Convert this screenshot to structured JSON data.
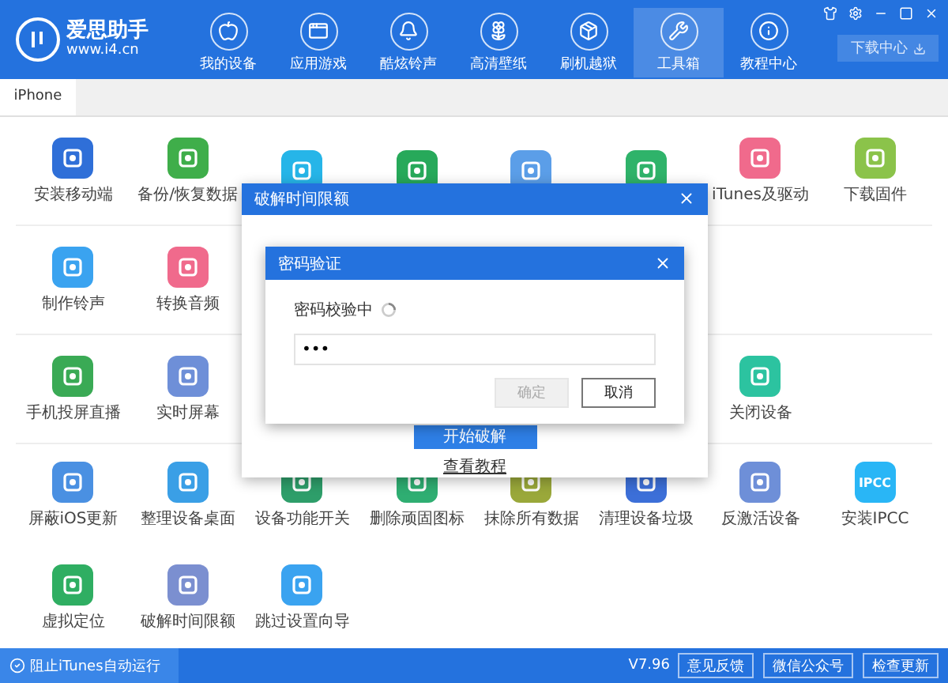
{
  "app": {
    "name": "爱思助手",
    "url": "www.i4.cn"
  },
  "nav": [
    {
      "label": "我的设备",
      "selected": false
    },
    {
      "label": "应用游戏",
      "selected": false
    },
    {
      "label": "酷炫铃声",
      "selected": false
    },
    {
      "label": "高清壁纸",
      "selected": false
    },
    {
      "label": "刷机越狱",
      "selected": false
    },
    {
      "label": "工具箱",
      "selected": true
    },
    {
      "label": "教程中心",
      "selected": false
    }
  ],
  "download_button": "下载中心",
  "tabs": [
    {
      "label": "iPhone",
      "selected": true
    }
  ],
  "tool_rows": [
    [
      {
        "kind": "tool",
        "label": "安装移动端",
        "color": "#2f6fd8"
      },
      {
        "kind": "tool",
        "label": "备份/恢复数据",
        "color": "#3fae4a"
      },
      {
        "kind": "tool",
        "color": "#26b5e8"
      },
      {
        "kind": "tool",
        "color": "#27a95a"
      },
      {
        "kind": "tool",
        "color": "#5b9ee8"
      },
      {
        "kind": "tool",
        "color": "#2fb36a"
      },
      {
        "kind": "tool",
        "label": "iTunes及驱动",
        "color": "#f06a8c"
      },
      {
        "kind": "tool",
        "label": "下载固件",
        "color": "#8bc34a"
      }
    ],
    [
      {
        "kind": "tool",
        "label": "制作铃声",
        "color": "#3aa3f0"
      },
      {
        "kind": "tool",
        "label": "转换音频",
        "color": "#f06a8c"
      },
      {
        "kind": "blank"
      },
      {
        "kind": "blank"
      },
      {
        "kind": "blank"
      },
      {
        "kind": "blank"
      },
      {
        "kind": "blank"
      },
      {
        "kind": "blank"
      }
    ],
    [
      {
        "kind": "tool",
        "label": "手机投屏直播",
        "color": "#3aaa55"
      },
      {
        "kind": "tool",
        "label": "实时屏幕",
        "color": "#6e8fd8"
      },
      {
        "kind": "blank"
      },
      {
        "kind": "blank"
      },
      {
        "kind": "blank"
      },
      {
        "kind": "blank"
      },
      {
        "kind": "tool",
        "label": "关闭设备",
        "color": "#2cc3a0"
      },
      {
        "kind": "blank"
      }
    ],
    [
      {
        "kind": "tool",
        "label": "屏蔽iOS更新",
        "color": "#4a90e2"
      },
      {
        "kind": "tool",
        "label": "整理设备桌面",
        "color": "#3a9fe6"
      },
      {
        "kind": "tool",
        "label": "设备功能开关",
        "color": "#2e9e6a"
      },
      {
        "kind": "tool",
        "label": "删除顽固图标",
        "color": "#2fae72"
      },
      {
        "kind": "tool",
        "label": "抹除所有数据",
        "color": "#9aa83a"
      },
      {
        "kind": "tool",
        "label": "清理设备垃圾",
        "color": "#3c6fd8"
      },
      {
        "kind": "tool",
        "label": "反激活设备",
        "color": "#6e8fd8"
      },
      {
        "kind": "tool",
        "label": "安装IPCC",
        "color": "#29b6f6",
        "icon_text": "IPCC"
      }
    ],
    [
      {
        "kind": "tool",
        "label": "虚拟定位",
        "color": "#2fae62"
      },
      {
        "kind": "tool",
        "label": "破解时间限额",
        "color": "#7b8fd0"
      },
      {
        "kind": "tool",
        "label": "跳过设置向导",
        "color": "#3aa3f0"
      }
    ]
  ],
  "dialog": {
    "title": "破解时间限额",
    "start_button": "开始破解",
    "tutorial_link": "查看教程"
  },
  "password_dialog": {
    "title": "密码验证",
    "status": "密码校验中",
    "password": "•••",
    "buttons": [
      {
        "label": "确定",
        "disabled": true
      },
      {
        "label": "取消",
        "disabled": false
      }
    ]
  },
  "status_bar": {
    "itunes_block": "阻止iTunes自动运行",
    "version": "V7.96",
    "buttons": [
      "意见反馈",
      "微信公众号",
      "检查更新"
    ]
  }
}
